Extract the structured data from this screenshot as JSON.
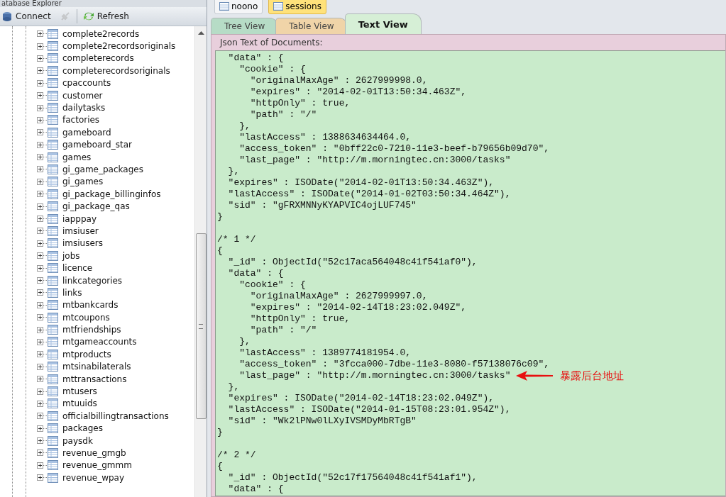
{
  "explorer": {
    "title": "atabase Explorer",
    "toolbar": [
      {
        "kind": "connect",
        "label": "Connect",
        "disabled": false
      },
      {
        "kind": "plug",
        "disabled": true
      },
      {
        "kind": "refresh",
        "label": "Refresh",
        "disabled": false
      }
    ],
    "tree": [
      {
        "label": "complete2records",
        "expanded": false
      },
      {
        "label": "complete2recordsoriginals",
        "expanded": false
      },
      {
        "label": "completerecords",
        "expanded": false
      },
      {
        "label": "completerecordsoriginals",
        "expanded": false
      },
      {
        "label": "cpaccounts",
        "expanded": false
      },
      {
        "label": "customer",
        "expanded": false
      },
      {
        "label": "dailytasks",
        "expanded": false
      },
      {
        "label": "factories",
        "expanded": false
      },
      {
        "label": "gameboard",
        "expanded": false
      },
      {
        "label": "gameboard_star",
        "expanded": false
      },
      {
        "label": "games",
        "expanded": false
      },
      {
        "label": "gi_game_packages",
        "expanded": false
      },
      {
        "label": "gi_games",
        "expanded": false
      },
      {
        "label": "gi_package_billinginfos",
        "expanded": false
      },
      {
        "label": "gi_package_qas",
        "expanded": false
      },
      {
        "label": "iapppay",
        "expanded": false
      },
      {
        "label": "imsiuser",
        "expanded": false
      },
      {
        "label": "imsiusers",
        "expanded": false
      },
      {
        "label": "jobs",
        "expanded": false
      },
      {
        "label": "licence",
        "expanded": false
      },
      {
        "label": "linkcategories",
        "expanded": false
      },
      {
        "label": "links",
        "expanded": false
      },
      {
        "label": "mtbankcards",
        "expanded": false
      },
      {
        "label": "mtcoupons",
        "expanded": false
      },
      {
        "label": "mtfriendships",
        "expanded": false
      },
      {
        "label": "mtgameaccounts",
        "expanded": false
      },
      {
        "label": "mtproducts",
        "expanded": false
      },
      {
        "label": "mtsinabilaterals",
        "expanded": false
      },
      {
        "label": "mttransactions",
        "expanded": false
      },
      {
        "label": "mtusers",
        "expanded": false
      },
      {
        "label": "mtuuids",
        "expanded": false
      },
      {
        "label": "officialbillingtransactions",
        "expanded": false
      },
      {
        "label": "packages",
        "expanded": false
      },
      {
        "label": "paysdk",
        "expanded": false
      },
      {
        "label": "revenue_gmgb",
        "expanded": false
      },
      {
        "label": "revenue_gmmm",
        "expanded": false
      },
      {
        "label": "revenue_wpay",
        "expanded": false
      }
    ]
  },
  "doc_tabs": [
    {
      "label": "noono",
      "selected": false
    },
    {
      "label": "sessions",
      "selected": true
    }
  ],
  "view_tabs": [
    {
      "label": "Tree View",
      "selected": false,
      "color": "#b6dcc6"
    },
    {
      "label": "Table View",
      "selected": false,
      "color": "#f0d4a8"
    },
    {
      "label": "Text View",
      "selected": true,
      "color": "#d6efd6"
    }
  ],
  "text_view": {
    "caption": "Json Text of Documents:",
    "blocks": [
      [
        {
          "text": "  \"data\" : {"
        },
        {
          "text": "    \"cookie\" : {"
        },
        {
          "text": "      \"originalMaxAge\" : 2627999998.0,"
        },
        {
          "text": "      \"expires\" : \"2014-02-01T13:50:34.463Z\","
        },
        {
          "text": "      \"httpOnly\" : true,"
        },
        {
          "text": "      \"path\" : \"/\""
        },
        {
          "text": "    },"
        },
        {
          "text": "    \"lastAccess\" : 1388634634464.0,"
        },
        {
          "text": "    \"access_token\" : \"0bff22c0-7210-11e3-beef-b79656b09d70\","
        },
        {
          "text": "    \"last_page\" : \"http://m.morningtec.cn:3000/tasks\""
        },
        {
          "text": "  },"
        },
        {
          "text": "  \"expires\" : ISODate(\"2014-02-01T13:50:34.463Z\"),"
        },
        {
          "text": "  \"lastAccess\" : ISODate(\"2014-01-02T03:50:34.464Z\"),"
        },
        {
          "text": "  \"sid\" : \"gFRXMNNyKYAPVIC4ojLUF745\""
        },
        {
          "text": "}"
        }
      ],
      [
        {
          "text": "/* 1 */"
        },
        {
          "text": "{"
        },
        {
          "text": "  \"_id\" : ObjectId(\"52c17aca564048c41f541af0\"),"
        },
        {
          "text": "  \"data\" : {"
        },
        {
          "text": "    \"cookie\" : {"
        },
        {
          "text": "      \"originalMaxAge\" : 2627999997.0,"
        },
        {
          "text": "      \"expires\" : \"2014-02-14T18:23:02.049Z\","
        },
        {
          "text": "      \"httpOnly\" : true,"
        },
        {
          "text": "      \"path\" : \"/\""
        },
        {
          "text": "    },"
        },
        {
          "text": "    \"lastAccess\" : 1389774181954.0,"
        },
        {
          "text": "    \"access_token\" : \"3fcca000-7dbe-11e3-8080-f57138076c09\","
        },
        {
          "text": "    \"last_page\" : \"http://m.morningtec.cn:3000/tasks\"",
          "note": "暴露后台地址"
        },
        {
          "text": "  },"
        },
        {
          "text": "  \"expires\" : ISODate(\"2014-02-14T18:23:02.049Z\"),"
        },
        {
          "text": "  \"lastAccess\" : ISODate(\"2014-01-15T08:23:01.954Z\"),"
        },
        {
          "text": "  \"sid\" : \"Wk2lPNw0lLXyIVSMDyMbRTgB\""
        },
        {
          "text": "}"
        }
      ],
      [
        {
          "text": "/* 2 */"
        },
        {
          "text": "{"
        },
        {
          "text": "  \"_id\" : ObjectId(\"52c17f17564048c41f541af1\"),"
        },
        {
          "text": "  \"data\" : {"
        }
      ]
    ]
  }
}
